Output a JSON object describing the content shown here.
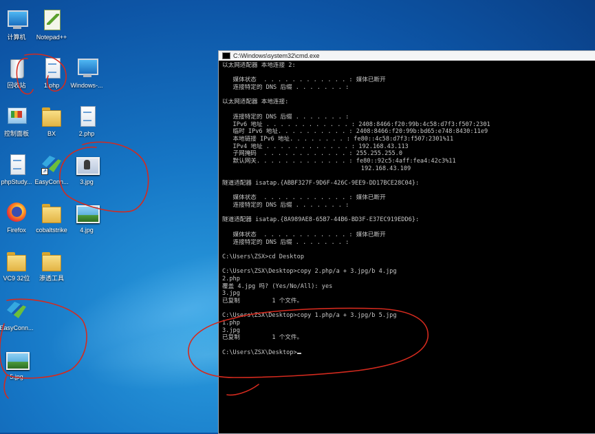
{
  "desktop_icons": [
    {
      "id": "computer",
      "label": "计算机",
      "icon": "computer-icon"
    },
    {
      "id": "notepadpp",
      "label": "Notepad++",
      "icon": "notepad-icon"
    },
    {
      "id": "recycle",
      "label": "回收站",
      "icon": "recycle-bin-icon"
    },
    {
      "id": "1php",
      "label": "1.php",
      "icon": "document-icon"
    },
    {
      "id": "windows",
      "label": "Windows-...",
      "icon": "window-icon"
    },
    {
      "id": "control",
      "label": "控制面板",
      "icon": "control-panel-icon"
    },
    {
      "id": "bx",
      "label": "BX",
      "icon": "folder-icon"
    },
    {
      "id": "2php",
      "label": "2.php",
      "icon": "document-icon"
    },
    {
      "id": "phpstudy",
      "label": "phpStudy...",
      "icon": "document-icon"
    },
    {
      "id": "easyconn1",
      "label": "EasyConn...",
      "icon": "easyconnect-icon"
    },
    {
      "id": "3jpg",
      "label": "3.jpg",
      "icon": "image-icon"
    },
    {
      "id": "firefox",
      "label": "Firefox",
      "icon": "firefox-icon"
    },
    {
      "id": "cobalt",
      "label": "cobaltstrike",
      "icon": "folder-icon"
    },
    {
      "id": "4jpg",
      "label": "4.jpg",
      "icon": "image-icon"
    },
    {
      "id": "vc9",
      "label": "VC9 32位",
      "icon": "folder-icon"
    },
    {
      "id": "shentou",
      "label": "渗透工具",
      "icon": "folder-icon"
    },
    {
      "id": "easyconn2",
      "label": "EasyConn...",
      "icon": "easyconnect-icon"
    },
    {
      "id": "5jpg",
      "label": "5.jpg",
      "icon": "image-icon"
    }
  ],
  "cmd": {
    "title": "C:\\Windows\\system32\\cmd.exe",
    "lines": [
      "以太网适配器 本地连接 2:",
      "",
      "   媒体状态  . . . . . . . . . . . . : 媒体已断开",
      "   连接特定的 DNS 后缀 . . . . . . . :",
      "",
      "以太网适配器 本地连接:",
      "",
      "   连接特定的 DNS 后缀 . . . . . . . :",
      "   IPv6 地址 . . . . . . . . . . . . : 2408:8466:f20:99b:4c58:d7f3:f507:2301",
      "   临时 IPv6 地址. . . . . . . . . . : 2408:8466:f20:99b:bd65:e748:8430:11e9",
      "   本地链接 IPv6 地址. . . . . . . . : fe80::4c58:d7f3:f507:2301%11",
      "   IPv4 地址 . . . . . . . . . . . . : 192.168.43.113",
      "   子网掩码  . . . . . . . . . . . . : 255.255.255.0",
      "   默认网关. . . . . . . . . . . . . : fe80::92c5:4aff:fea4:42c3%11",
      "                                       192.168.43.109",
      "",
      "隧道适配器 isatap.{ABBF327F-9D6F-426C-9EE9-DD17BCE28C04}:",
      "",
      "   媒体状态  . . . . . . . . . . . . : 媒体已断开",
      "   连接特定的 DNS 后缀 . . . . . . . :",
      "",
      "隧道适配器 isatap.{8A989AE8-65B7-44B6-BD3F-E37EC919EDD6}:",
      "",
      "   媒体状态  . . . . . . . . . . . . : 媒体已断开",
      "   连接特定的 DNS 后缀 . . . . . . . :",
      "",
      "C:\\Users\\ZSX>cd Desktop",
      "",
      "C:\\Users\\ZSX\\Desktop>copy 2.php/a + 3.jpg/b 4.jpg",
      "2.php",
      "覆盖 4.jpg 吗? (Yes/No/All): yes",
      "3.jpg",
      "已复制         1 个文件。",
      "",
      "C:\\Users\\ZSX\\Desktop>copy 1.php/a + 3.jpg/b 5.jpg",
      "1.php",
      "3.jpg",
      "已复制         1 个文件。",
      "",
      "C:\\Users\\ZSX\\Desktop>"
    ]
  },
  "colors": {
    "ink": "#d42a1e",
    "console_text": "#c8c8c8",
    "console_bg": "#000000"
  }
}
